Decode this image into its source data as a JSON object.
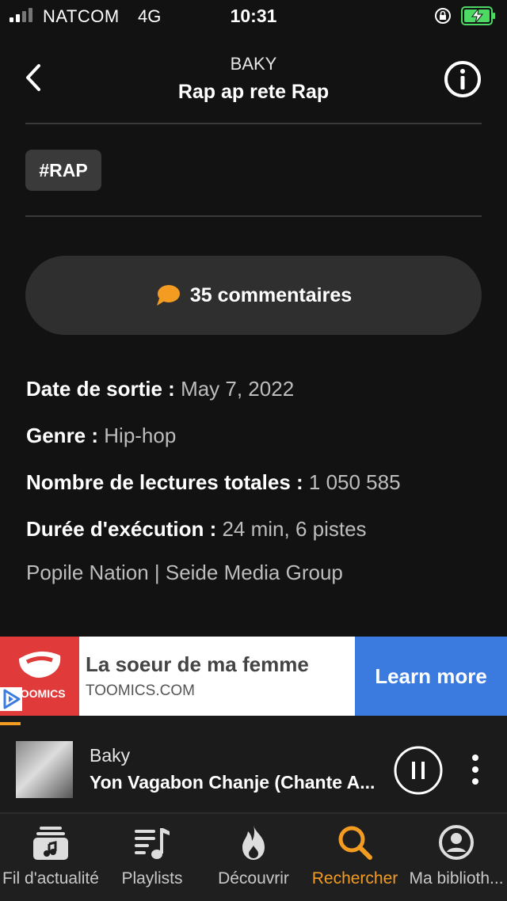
{
  "status_bar": {
    "carrier": "NATCOM",
    "network": "4G",
    "time": "10:31"
  },
  "header": {
    "artist": "BAKY",
    "album_title": "Rap ap rete Rap"
  },
  "tag": "#RAP",
  "comments": {
    "label": "35 commentaires"
  },
  "details": [
    {
      "label": "Date de sortie :",
      "value": "May 7, 2022"
    },
    {
      "label": "Genre :",
      "value": "Hip-hop"
    },
    {
      "label": "Nombre de lectures totales :",
      "value": "1 050 585"
    },
    {
      "label": "Durée d'exécution :",
      "value": "24 min, 6 pistes"
    }
  ],
  "credits": "Popile Nation | Seide Media Group",
  "ad": {
    "logo_text": "TOOMICS",
    "title": "La soeur de ma femme",
    "url": "TOOMICS.COM",
    "cta": "Learn more"
  },
  "now_playing": {
    "artist": "Baky",
    "title": "Yon Vagabon Chanje (Chante A...",
    "progress_fraction": 0.04
  },
  "tabs": [
    {
      "label": "Fil d'actualité",
      "icon": "feed-icon",
      "active": false
    },
    {
      "label": "Playlists",
      "icon": "playlist-icon",
      "active": false
    },
    {
      "label": "Découvrir",
      "icon": "flame-icon",
      "active": false
    },
    {
      "label": "Rechercher",
      "icon": "search-icon",
      "active": true
    },
    {
      "label": "Ma biblioth...",
      "icon": "library-icon",
      "active": false
    }
  ],
  "colors": {
    "accent": "#f39c21",
    "background": "#121212",
    "ad_cta": "#3b7be0",
    "ad_logo": "#e03a3a"
  }
}
